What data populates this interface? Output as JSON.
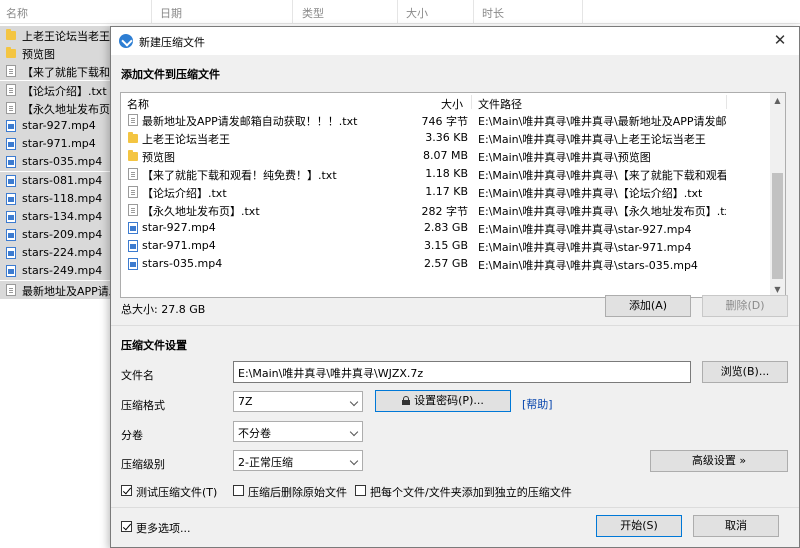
{
  "background": {
    "columns": [
      "名称",
      "日期",
      "类型",
      "大小",
      "时长"
    ],
    "rows": [
      {
        "icon": "folder",
        "name": "上老王论坛当老王"
      },
      {
        "icon": "folder",
        "name": "预览图"
      },
      {
        "icon": "txt",
        "name": "【来了就能下载和观"
      },
      {
        "icon": "txt",
        "name": "【论坛介绍】.txt"
      },
      {
        "icon": "txt",
        "name": "【永久地址发布页】"
      },
      {
        "icon": "mp4",
        "name": "star-927.mp4"
      },
      {
        "icon": "mp4",
        "name": "star-971.mp4"
      },
      {
        "icon": "mp4",
        "name": "stars-035.mp4"
      },
      {
        "icon": "mp4",
        "name": "stars-081.mp4"
      },
      {
        "icon": "mp4",
        "name": "stars-118.mp4"
      },
      {
        "icon": "mp4",
        "name": "stars-134.mp4"
      },
      {
        "icon": "mp4",
        "name": "stars-209.mp4"
      },
      {
        "icon": "mp4",
        "name": "stars-224.mp4"
      },
      {
        "icon": "mp4",
        "name": "stars-249.mp4"
      },
      {
        "icon": "txt",
        "name": "最新地址及APP请发"
      }
    ]
  },
  "dialog": {
    "title": "新建压缩文件",
    "close_symbol": "✕",
    "add_section_label": "添加文件到压缩文件",
    "list": {
      "headers": {
        "name": "名称",
        "size": "大小",
        "path": "文件路径"
      },
      "rows": [
        {
          "icon": "txt",
          "name": "最新地址及APP请发邮箱自动获取！！！.txt",
          "size": "746 字节",
          "path": "E:\\Main\\唯井真寻\\唯井真寻\\最新地址及APP请发邮..."
        },
        {
          "icon": "folder",
          "name": "上老王论坛当老王",
          "size": "3.36 KB",
          "path": "E:\\Main\\唯井真寻\\唯井真寻\\上老王论坛当老王"
        },
        {
          "icon": "folder",
          "name": "预览图",
          "size": "8.07 MB",
          "path": "E:\\Main\\唯井真寻\\唯井真寻\\预览图"
        },
        {
          "icon": "txt",
          "name": "【来了就能下载和观看！纯免费！】.txt",
          "size": "1.18 KB",
          "path": "E:\\Main\\唯井真寻\\唯井真寻\\【来了就能下载和观看..."
        },
        {
          "icon": "txt",
          "name": "【论坛介绍】.txt",
          "size": "1.17 KB",
          "path": "E:\\Main\\唯井真寻\\唯井真寻\\【论坛介绍】.txt"
        },
        {
          "icon": "txt",
          "name": "【永久地址发布页】.txt",
          "size": "282 字节",
          "path": "E:\\Main\\唯井真寻\\唯井真寻\\【永久地址发布页】.txt"
        },
        {
          "icon": "mp4",
          "name": "star-927.mp4",
          "size": "2.83 GB",
          "path": "E:\\Main\\唯井真寻\\唯井真寻\\star-927.mp4"
        },
        {
          "icon": "mp4",
          "name": "star-971.mp4",
          "size": "3.15 GB",
          "path": "E:\\Main\\唯井真寻\\唯井真寻\\star-971.mp4"
        },
        {
          "icon": "mp4",
          "name": "stars-035.mp4",
          "size": "2.57 GB",
          "path": "E:\\Main\\唯井真寻\\唯井真寻\\stars-035.mp4"
        }
      ]
    },
    "total_size": "总大小: 27.8 GB",
    "add_button": "添加(A)",
    "delete_button": "删除(D)",
    "settings_section_label": "压缩文件设置",
    "filename_label": "文件名",
    "filename_value": "E:\\Main\\唯井真寻\\唯井真寻\\WJZX.7z",
    "browse_button": "浏览(B)...",
    "format_label": "压缩格式",
    "format_value": "7Z",
    "password_button": "设置密码(P)...",
    "help_link": "[帮助]",
    "split_label": "分卷",
    "split_value": "不分卷",
    "level_label": "压缩级别",
    "level_value": "2-正常压缩",
    "advanced_button": "高级设置 »",
    "test_checkbox": {
      "label": "测试压缩文件(T)",
      "checked": true
    },
    "delete_after_checkbox": {
      "label": "压缩后删除原始文件",
      "checked": false
    },
    "separate_checkbox": {
      "label": "把每个文件/文件夹添加到独立的压缩文件",
      "checked": false
    },
    "more_options_checkbox": {
      "label": "更多选项...",
      "checked": true
    },
    "start_button": "开始(S)",
    "cancel_button": "取消"
  }
}
